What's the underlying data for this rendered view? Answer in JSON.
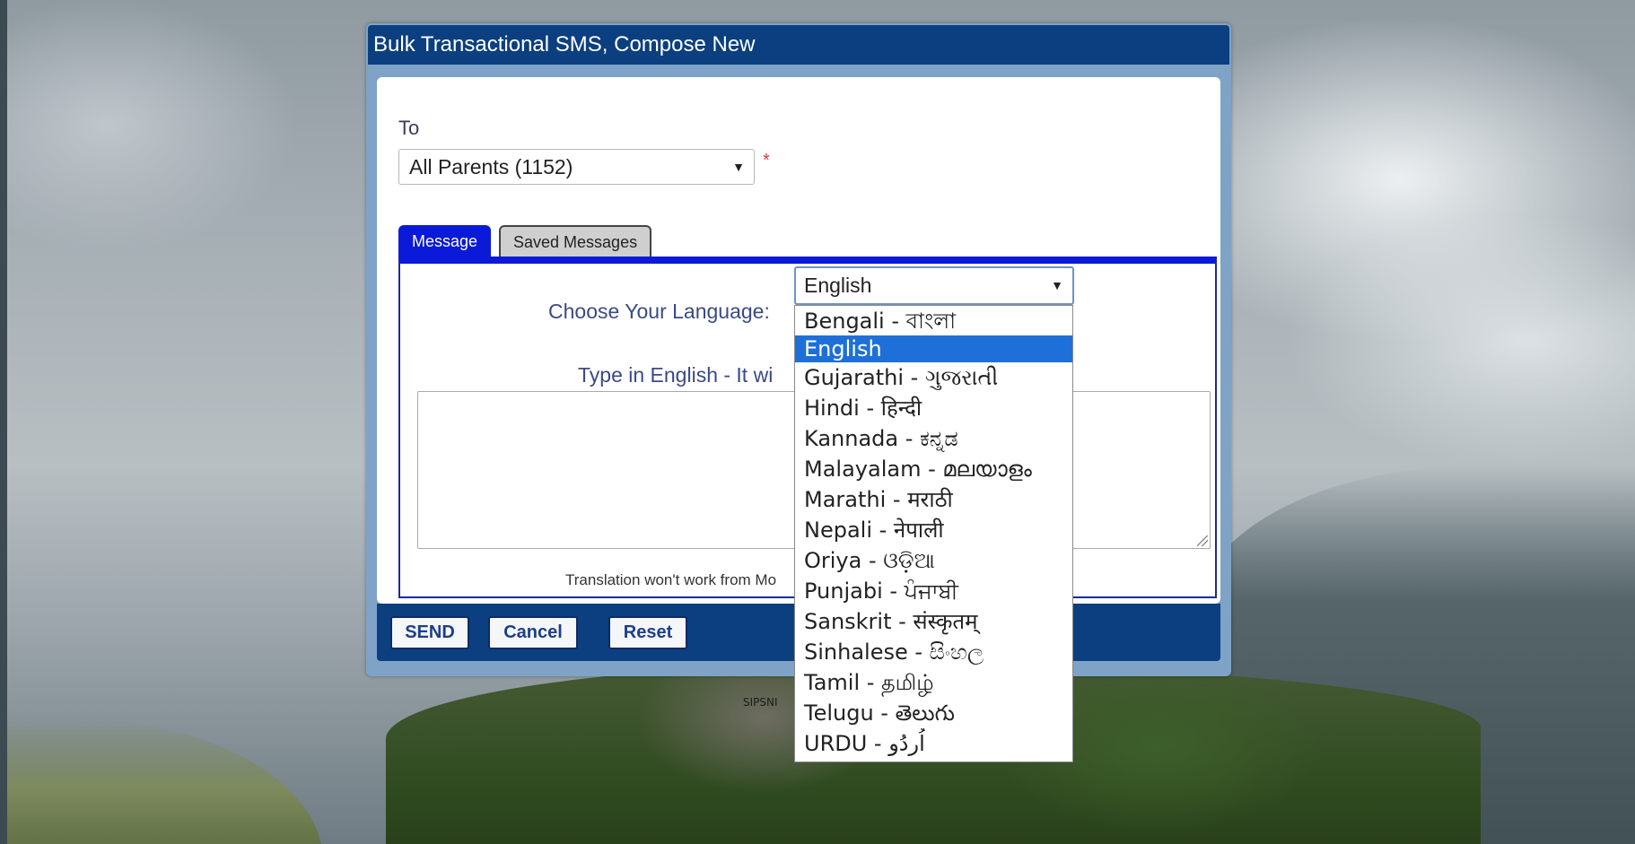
{
  "dialog": {
    "title": "Bulk Transactional SMS, Compose New"
  },
  "to": {
    "label": "To",
    "selected": "All Parents (1152)",
    "required_marker": "*"
  },
  "tabs": [
    {
      "label": "Message",
      "active": true
    },
    {
      "label": "Saved Messages",
      "active": false
    }
  ],
  "message": {
    "language_label": "Choose Your Language:",
    "language_selected": "English",
    "type_hint": "Type in English - It wi",
    "textarea_value": "",
    "note": "Translation won't work from Mo"
  },
  "language_options": [
    "Bengali - বাংলা",
    "English",
    "Gujarathi - ગુજરાતી",
    "Hindi - हिन्दी",
    "Kannada - ಕನ್ನಡ",
    "Malayalam - മലയാളം",
    "Marathi - मराठी",
    "Nepali - नेपाली",
    "Oriya - ଓଡ଼ିଆ",
    "Punjabi - ਪੰਜਾਬੀ",
    "Sanskrit - संस्कृतम्",
    "Sinhalese - සිංහල",
    "Tamil - தமிழ்",
    "Telugu - తెలుగు",
    "URDU - اُردُو"
  ],
  "language_selected_index": 1,
  "actions": {
    "send": "SEND",
    "cancel": "Cancel",
    "reset": "Reset"
  },
  "footer": {
    "text": "SIPSNI"
  },
  "icons": {
    "dropdown_arrow": "caret-down-icon",
    "resize": "resize-grip-icon"
  },
  "colors": {
    "title_bar": "#0b3f80",
    "active_tab": "#0a1ad8",
    "selected_option": "#1e70d8"
  }
}
